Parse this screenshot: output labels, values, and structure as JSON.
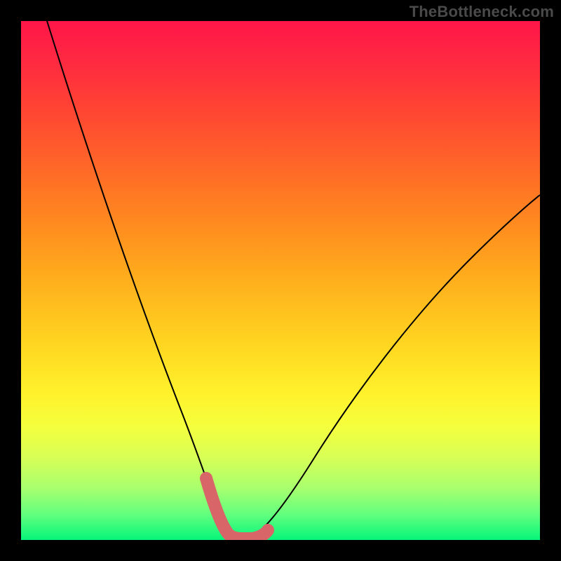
{
  "watermark": "TheBottleneck.com",
  "chart_data": {
    "type": "line",
    "title": "",
    "xlabel": "",
    "ylabel": "",
    "xlim": [
      0,
      100
    ],
    "ylim": [
      0,
      100
    ],
    "series": [
      {
        "name": "bottleneck-curve",
        "x": [
          5,
          8,
          12,
          16,
          20,
          24,
          28,
          31,
          33,
          35,
          36.5,
          38,
          40,
          43,
          48,
          55,
          62,
          70,
          78,
          86,
          94,
          100
        ],
        "y": [
          100,
          90,
          79,
          68,
          57,
          46,
          34,
          23,
          14,
          7,
          2,
          0,
          0,
          3,
          11,
          23,
          35,
          47,
          58,
          67,
          75,
          80
        ]
      },
      {
        "name": "optimal-range-marker",
        "x": [
          33,
          35,
          36.5,
          38,
          40,
          43
        ],
        "y": [
          14,
          7,
          2,
          0,
          0,
          3
        ]
      }
    ],
    "background_gradient": {
      "top": "#ff1648",
      "mid": "#fff22c",
      "bottom": "#05f57a"
    }
  }
}
